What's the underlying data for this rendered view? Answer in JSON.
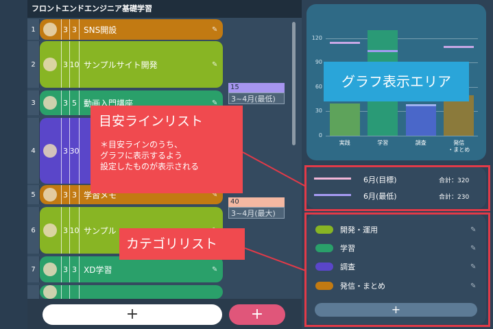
{
  "app": {
    "title": "フロントエンドエンジニア基礎学習"
  },
  "tasks": [
    {
      "num": "1",
      "a": "3",
      "b": "3",
      "name": "SNS開設",
      "color": "#c27a12"
    },
    {
      "num": "2",
      "a": "3",
      "b": "10",
      "name": "サンプルサイト開発",
      "color": "#88b524"
    },
    {
      "num": "3",
      "a": "3",
      "b": "5",
      "name": "動画入門講座",
      "color": "#2aa06a"
    },
    {
      "num": "4",
      "a": "3",
      "b": "30",
      "name": "",
      "color": "#5a46c9"
    },
    {
      "num": "5",
      "a": "3",
      "b": "3",
      "name": "学習メモ",
      "color": "#c27a12"
    },
    {
      "num": "6",
      "a": "3",
      "b": "10",
      "name": "サンプル",
      "color": "#88b524"
    },
    {
      "num": "7",
      "a": "3",
      "b": "3",
      "name": "XD学習",
      "color": "#2aa06a"
    },
    {
      "num": "",
      "a": "",
      "b": "",
      "name": "",
      "color": "#2aa06a"
    }
  ],
  "targets": [
    {
      "value": "15",
      "label": "3~4月(最低)",
      "color": "#a695f0"
    },
    {
      "value": "40",
      "label": "3~4月(最大)",
      "color": "#f4b8a2"
    }
  ],
  "buttons": {
    "add_task": "+",
    "add_target": "+",
    "add_category": "+"
  },
  "callouts": {
    "graph": "グラフ表示エリア",
    "guide_title": "目安ラインリスト",
    "guide_desc": [
      "＊目安ラインのうち、",
      "グラフに表示するよう",
      "設定したものが表示される"
    ],
    "category": "カテゴリリスト"
  },
  "chart_data": {
    "type": "bar",
    "categories": [
      "実践",
      "学習",
      "調査",
      "発信・まとめ"
    ],
    "category_lines": [
      [
        "実践"
      ],
      [
        "学習"
      ],
      [
        "調査"
      ],
      [
        "発信",
        "・まとめ"
      ]
    ],
    "values": [
      40,
      130,
      38,
      50
    ],
    "colors": [
      "#5ea35b",
      "#2a9a76",
      "#4a67c9",
      "#8b7a3b"
    ],
    "yticks": [
      0,
      30,
      60,
      90,
      120
    ],
    "ylim": [
      0,
      130
    ],
    "guide_lines": [
      {
        "value": 115,
        "color": "#c9a8e6"
      },
      {
        "value": 105,
        "color": "#a59bf3"
      },
      {
        "value": 38,
        "color": "#9fb2f0"
      },
      {
        "value": 110,
        "color": "#c9a8e6"
      }
    ],
    "grid": true
  },
  "guides": [
    {
      "label": "6月(目標)",
      "total": "合計：320",
      "color": "#f2b6d8"
    },
    {
      "label": "6月(最低)",
      "total": "合計：230",
      "color": "#a89cf5"
    }
  ],
  "categories": [
    {
      "label": "開発・運用",
      "color": "#88b524"
    },
    {
      "label": "学習",
      "color": "#2aa06a"
    },
    {
      "label": "調査",
      "color": "#5a46c9"
    },
    {
      "label": "発信・まとめ",
      "color": "#c27a12"
    }
  ]
}
